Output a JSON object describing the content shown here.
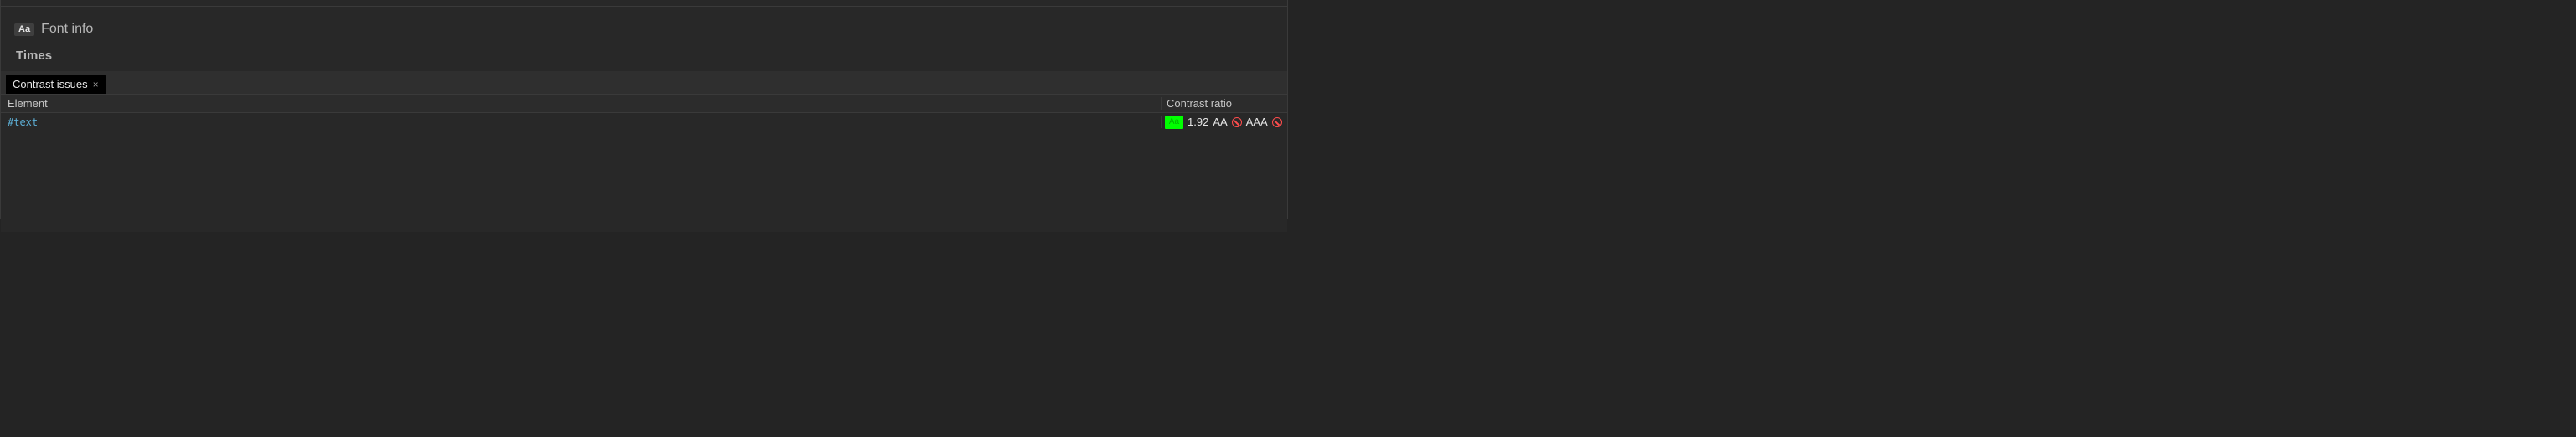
{
  "font_info": {
    "badge": "Aa",
    "title": "Font info",
    "family": "Times"
  },
  "tab": {
    "label": "Contrast issues",
    "close": "×"
  },
  "table": {
    "headers": {
      "element": "Element",
      "contrast": "Contrast ratio"
    },
    "row": {
      "element": "#text",
      "swatch_text": "Aa",
      "swatch_color": "#00ff00",
      "ratio": "1.92",
      "aa_label": "AA",
      "aa_passes": false,
      "aaa_label": "AAA",
      "aaa_passes": false
    }
  }
}
